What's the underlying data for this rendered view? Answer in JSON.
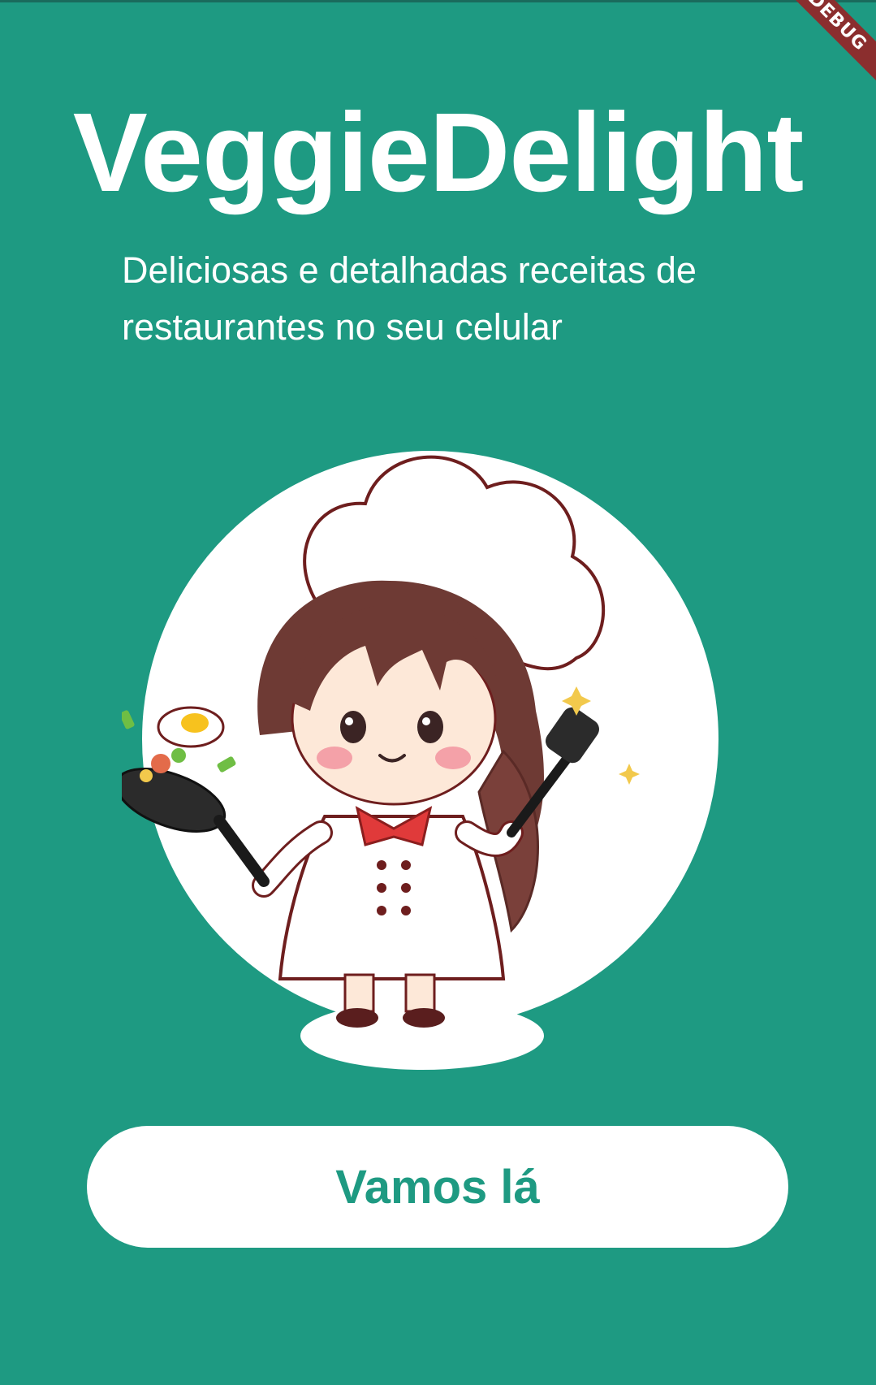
{
  "app": {
    "title": "VeggieDelight",
    "subtitle": "Deliciosas e detalhadas receitas de restaurantes no seu celular",
    "debug_banner": "DEBUG"
  },
  "hero": {
    "illustration_icon": "chef-girl-illustration"
  },
  "actions": {
    "primary_label": "Vamos lá"
  },
  "colors": {
    "background": "#1e9a82",
    "button_background": "#ffffff",
    "button_text": "#1e9a82",
    "title_text": "#ffffff",
    "debug_banner": "#8b2e2e"
  }
}
